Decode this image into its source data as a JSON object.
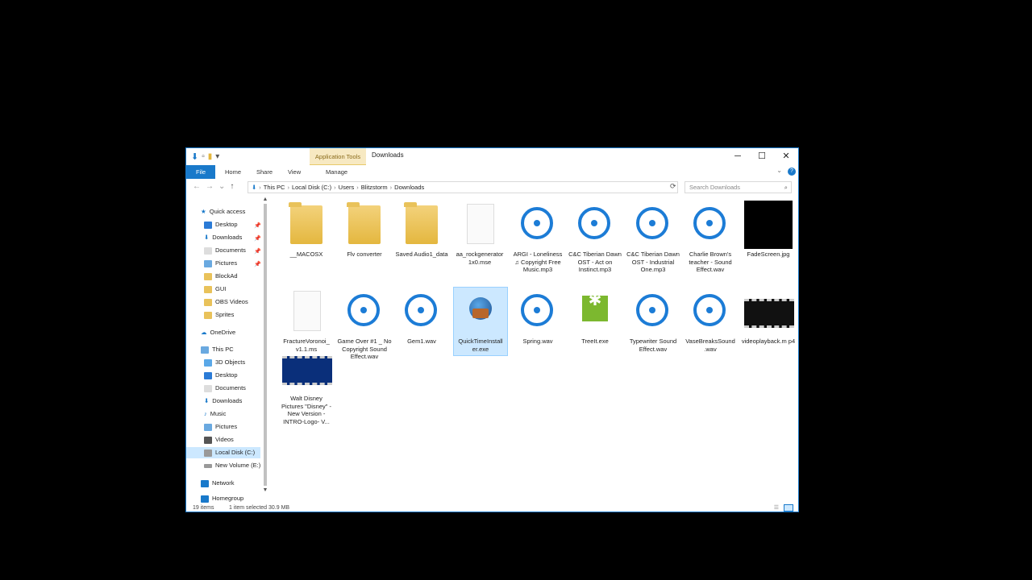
{
  "window": {
    "title": "Downloads",
    "contextual_tab": "Application Tools",
    "controls": {
      "minimize": "─",
      "maximize": "☐",
      "close": "✕"
    }
  },
  "ribbon": {
    "tabs": [
      "File",
      "Home",
      "Share",
      "View",
      "Manage"
    ]
  },
  "address": {
    "path": [
      "This PC",
      "Local Disk (C:)",
      "Users",
      "Blitzstorm",
      "Downloads"
    ],
    "search_placeholder": "Search Downloads"
  },
  "nav": {
    "quick_access": "Quick access",
    "quick_items": [
      "Desktop",
      "Downloads",
      "Documents",
      "Pictures",
      "BlockAd",
      "GUI",
      "OBS Videos",
      "Sprites"
    ],
    "onedrive": "OneDrive",
    "this_pc": "This PC",
    "pc_items": [
      "3D Objects",
      "Desktop",
      "Documents",
      "Downloads",
      "Music",
      "Pictures",
      "Videos",
      "Local Disk (C:)",
      "New Volume (E:)"
    ],
    "network": "Network",
    "homegroup": "Homegroup"
  },
  "files": [
    {
      "name": "__MACOSX",
      "kind": "folder"
    },
    {
      "name": "Flv converter",
      "kind": "folder"
    },
    {
      "name": "Saved Audio1_data",
      "kind": "folder"
    },
    {
      "name": "aa_rockgenerator 1x0.mse",
      "kind": "blank"
    },
    {
      "name": "ARGI - Loneliness ♫ Copyright Free Music.mp3",
      "kind": "music"
    },
    {
      "name": "C&C Tiberian Dawn OST - Act on Instinct.mp3",
      "kind": "music"
    },
    {
      "name": "C&C Tiberian Dawn OST - Industrial One.mp3",
      "kind": "music"
    },
    {
      "name": "Charlie Brown's teacher - Sound Effect.wav",
      "kind": "music"
    },
    {
      "name": "FadeScreen.jpg",
      "kind": "black"
    },
    {
      "name": "FractureVoronoi_ v1.1.ms",
      "kind": "blank"
    },
    {
      "name": "Game Over #1 _ No Copyright Sound Effect.wav",
      "kind": "music"
    },
    {
      "name": "Gem1.wav",
      "kind": "music"
    },
    {
      "name": "QuickTimeInstall er.exe",
      "kind": "exe"
    },
    {
      "name": "Spring.wav",
      "kind": "music"
    },
    {
      "name": "TreeIt.exe",
      "kind": "tree"
    },
    {
      "name": "Typewriter Sound Effect.wav",
      "kind": "music"
    },
    {
      "name": "VaseBreaksSound .wav",
      "kind": "music"
    },
    {
      "name": "videoplayback.m p4",
      "kind": "video"
    },
    {
      "name": "Walt Disney Pictures \"Disney\" - New Version - INTRO-Logo- V...",
      "kind": "video-blue"
    }
  ],
  "status": {
    "count": "19 items",
    "selection": "1 item selected  30.9 MB"
  }
}
